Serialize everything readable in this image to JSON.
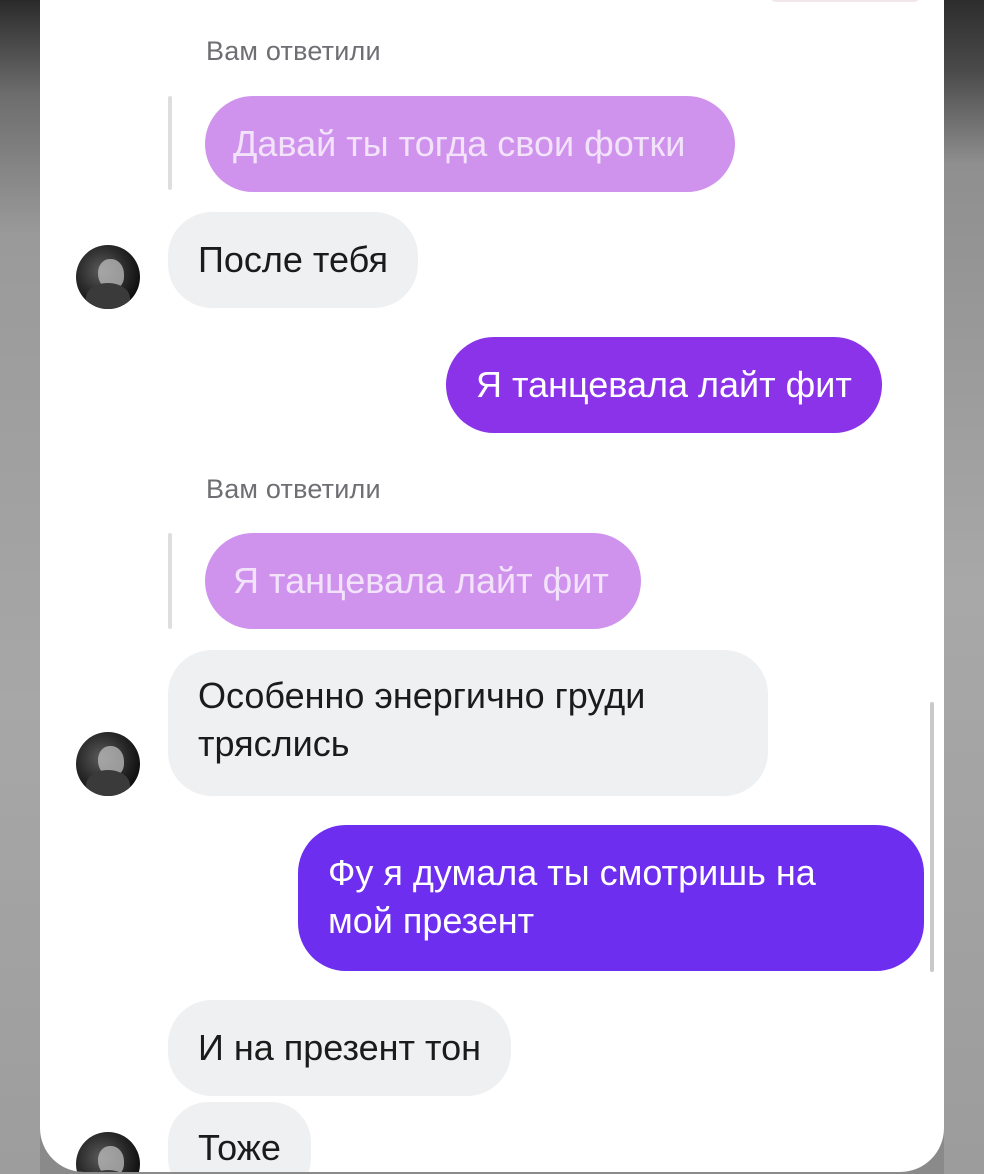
{
  "chat": {
    "reply_label_1": "Вам ответили",
    "quoted_1": "Давай ты тогда свои фотки",
    "msg_in_1": "После тебя",
    "msg_out_1": "Я танцевала лайт фит",
    "reply_label_2": "Вам ответили",
    "quoted_2": "Я танцевала лайт фит",
    "msg_in_2_line1": "Особенно энергично груди",
    "msg_in_2_line2": "тряслись",
    "msg_out_2_line1": "Фу я думала ты смотришь на",
    "msg_out_2_line2": "мой презент",
    "msg_in_3": "И на презент тон",
    "msg_in_4": "Тоже"
  },
  "colors": {
    "quoted_bubble": "#cf93ed",
    "incoming_bubble": "#eff0f2",
    "outgoing_bubble_1": "#8b33e9",
    "outgoing_bubble_2": "#6d2ef0"
  },
  "icons": {
    "avatar": "avatar-photo"
  }
}
